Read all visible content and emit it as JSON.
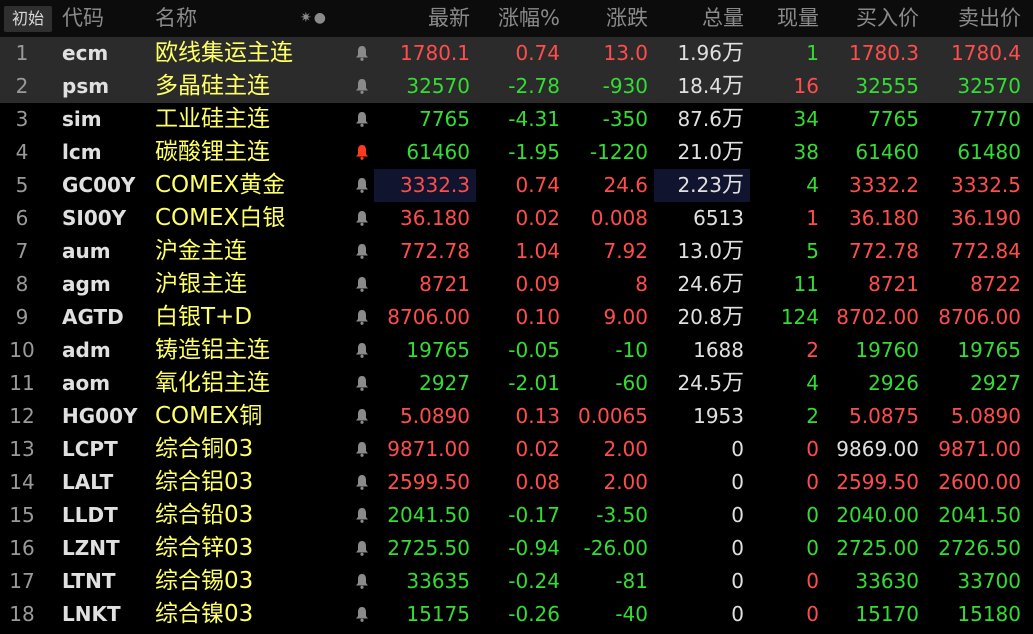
{
  "colors": {
    "up": "#ff4d4d",
    "down": "#33dd33",
    "name": "#ffff66",
    "background": "#000000"
  },
  "header": {
    "tab_label": "初始",
    "icons_text": "✷●",
    "columns": {
      "code": "代码",
      "name": "名称",
      "last": "最新",
      "pct": "涨幅%",
      "chg": "涨跌",
      "vol": "总量",
      "cur": "现量",
      "bid": "买入价",
      "ask": "卖出价"
    }
  },
  "rows": [
    {
      "idx": "1",
      "code": "ecm",
      "name": "欧线集运主连",
      "alert": false,
      "last": "1780.1",
      "pct": "0.74",
      "chg": "13.0",
      "vol": "1.96",
      "vol_unit": "万",
      "cur": "1",
      "bid": "1780.3",
      "ask": "1780.4",
      "last_dir": "up",
      "pct_dir": "up",
      "chg_dir": "up",
      "cur_dir": "down",
      "bid_dir": "up",
      "ask_dir": "up"
    },
    {
      "idx": "2",
      "code": "psm",
      "name": "多晶硅主连",
      "alert": false,
      "last": "32570",
      "pct": "-2.78",
      "chg": "-930",
      "vol": "18.4",
      "vol_unit": "万",
      "cur": "16",
      "bid": "32555",
      "ask": "32570",
      "last_dir": "down",
      "pct_dir": "down",
      "chg_dir": "down",
      "cur_dir": "up",
      "bid_dir": "down",
      "ask_dir": "down"
    },
    {
      "idx": "3",
      "code": "sim",
      "name": "工业硅主连",
      "alert": false,
      "last": "7765",
      "pct": "-4.31",
      "chg": "-350",
      "vol": "87.6",
      "vol_unit": "万",
      "cur": "34",
      "bid": "7765",
      "ask": "7770",
      "last_dir": "down",
      "pct_dir": "down",
      "chg_dir": "down",
      "cur_dir": "down",
      "bid_dir": "down",
      "ask_dir": "down"
    },
    {
      "idx": "4",
      "code": "lcm",
      "name": "碳酸锂主连",
      "alert": true,
      "last": "61460",
      "pct": "-1.95",
      "chg": "-1220",
      "vol": "21.0",
      "vol_unit": "万",
      "cur": "38",
      "bid": "61460",
      "ask": "61480",
      "last_dir": "down",
      "pct_dir": "down",
      "chg_dir": "down",
      "cur_dir": "down",
      "bid_dir": "down",
      "ask_dir": "down"
    },
    {
      "idx": "5",
      "code": "GC00Y",
      "name": "COMEX黄金",
      "alert": false,
      "last": "3332.3",
      "pct": "0.74",
      "chg": "24.6",
      "vol": "2.23",
      "vol_unit": "万",
      "cur": "4",
      "bid": "3332.2",
      "ask": "3332.5",
      "last_dir": "up",
      "pct_dir": "up",
      "chg_dir": "up",
      "cur_dir": "down",
      "bid_dir": "up",
      "ask_dir": "up"
    },
    {
      "idx": "6",
      "code": "SI00Y",
      "name": "COMEX白银",
      "alert": false,
      "last": "36.180",
      "pct": "0.02",
      "chg": "0.008",
      "vol": "6513",
      "vol_unit": "",
      "cur": "1",
      "bid": "36.180",
      "ask": "36.190",
      "last_dir": "up",
      "pct_dir": "up",
      "chg_dir": "up",
      "cur_dir": "up",
      "bid_dir": "up",
      "ask_dir": "up"
    },
    {
      "idx": "7",
      "code": "aum",
      "name": "沪金主连",
      "alert": false,
      "last": "772.78",
      "pct": "1.04",
      "chg": "7.92",
      "vol": "13.0",
      "vol_unit": "万",
      "cur": "5",
      "bid": "772.78",
      "ask": "772.84",
      "last_dir": "up",
      "pct_dir": "up",
      "chg_dir": "up",
      "cur_dir": "down",
      "bid_dir": "up",
      "ask_dir": "up"
    },
    {
      "idx": "8",
      "code": "agm",
      "name": "沪银主连",
      "alert": false,
      "last": "8721",
      "pct": "0.09",
      "chg": "8",
      "vol": "24.6",
      "vol_unit": "万",
      "cur": "11",
      "bid": "8721",
      "ask": "8722",
      "last_dir": "up",
      "pct_dir": "up",
      "chg_dir": "up",
      "cur_dir": "down",
      "bid_dir": "up",
      "ask_dir": "up"
    },
    {
      "idx": "9",
      "code": "AGTD",
      "name": "白银T+D",
      "alert": false,
      "last": "8706.00",
      "pct": "0.10",
      "chg": "9.00",
      "vol": "20.8",
      "vol_unit": "万",
      "cur": "124",
      "bid": "8702.00",
      "ask": "8706.00",
      "last_dir": "up",
      "pct_dir": "up",
      "chg_dir": "up",
      "cur_dir": "down",
      "bid_dir": "up",
      "ask_dir": "up"
    },
    {
      "idx": "10",
      "code": "adm",
      "name": "铸造铝主连",
      "alert": false,
      "last": "19765",
      "pct": "-0.05",
      "chg": "-10",
      "vol": "1688",
      "vol_unit": "",
      "cur": "2",
      "bid": "19760",
      "ask": "19765",
      "last_dir": "down",
      "pct_dir": "down",
      "chg_dir": "down",
      "cur_dir": "up",
      "bid_dir": "down",
      "ask_dir": "down"
    },
    {
      "idx": "11",
      "code": "aom",
      "name": "氧化铝主连",
      "alert": false,
      "last": "2927",
      "pct": "-2.01",
      "chg": "-60",
      "vol": "24.5",
      "vol_unit": "万",
      "cur": "4",
      "bid": "2926",
      "ask": "2927",
      "last_dir": "down",
      "pct_dir": "down",
      "chg_dir": "down",
      "cur_dir": "down",
      "bid_dir": "down",
      "ask_dir": "down"
    },
    {
      "idx": "12",
      "code": "HG00Y",
      "name": "COMEX铜",
      "alert": false,
      "last": "5.0890",
      "pct": "0.13",
      "chg": "0.0065",
      "vol": "1953",
      "vol_unit": "",
      "cur": "2",
      "bid": "5.0875",
      "ask": "5.0890",
      "last_dir": "up",
      "pct_dir": "up",
      "chg_dir": "up",
      "cur_dir": "down",
      "bid_dir": "up",
      "ask_dir": "up"
    },
    {
      "idx": "13",
      "code": "LCPT",
      "name": "综合铜03",
      "alert": false,
      "last": "9871.00",
      "pct": "0.02",
      "chg": "2.00",
      "vol": "0",
      "vol_unit": "",
      "cur": "0",
      "bid": "9869.00",
      "ask": "9871.00",
      "last_dir": "up",
      "pct_dir": "up",
      "chg_dir": "up",
      "cur_dir": "up",
      "bid_dir": "flat",
      "ask_dir": "up"
    },
    {
      "idx": "14",
      "code": "LALT",
      "name": "综合铝03",
      "alert": false,
      "last": "2599.50",
      "pct": "0.08",
      "chg": "2.00",
      "vol": "0",
      "vol_unit": "",
      "cur": "0",
      "bid": "2599.50",
      "ask": "2600.00",
      "last_dir": "up",
      "pct_dir": "up",
      "chg_dir": "up",
      "cur_dir": "up",
      "bid_dir": "up",
      "ask_dir": "up"
    },
    {
      "idx": "15",
      "code": "LLDT",
      "name": "综合铅03",
      "alert": false,
      "last": "2041.50",
      "pct": "-0.17",
      "chg": "-3.50",
      "vol": "0",
      "vol_unit": "",
      "cur": "0",
      "bid": "2040.00",
      "ask": "2041.50",
      "last_dir": "down",
      "pct_dir": "down",
      "chg_dir": "down",
      "cur_dir": "down",
      "bid_dir": "down",
      "ask_dir": "down"
    },
    {
      "idx": "16",
      "code": "LZNT",
      "name": "综合锌03",
      "alert": false,
      "last": "2725.50",
      "pct": "-0.94",
      "chg": "-26.00",
      "vol": "0",
      "vol_unit": "",
      "cur": "0",
      "bid": "2725.00",
      "ask": "2726.50",
      "last_dir": "down",
      "pct_dir": "down",
      "chg_dir": "down",
      "cur_dir": "down",
      "bid_dir": "down",
      "ask_dir": "down"
    },
    {
      "idx": "17",
      "code": "LTNT",
      "name": "综合锡03",
      "alert": false,
      "last": "33635",
      "pct": "-0.24",
      "chg": "-81",
      "vol": "0",
      "vol_unit": "",
      "cur": "0",
      "bid": "33630",
      "ask": "33700",
      "last_dir": "down",
      "pct_dir": "down",
      "chg_dir": "down",
      "cur_dir": "up",
      "bid_dir": "down",
      "ask_dir": "down"
    },
    {
      "idx": "18",
      "code": "LNKT",
      "name": "综合镍03",
      "alert": false,
      "last": "15175",
      "pct": "-0.26",
      "chg": "-40",
      "vol": "0",
      "vol_unit": "",
      "cur": "0",
      "bid": "15170",
      "ask": "15180",
      "last_dir": "down",
      "pct_dir": "down",
      "chg_dir": "down",
      "cur_dir": "up",
      "bid_dir": "down",
      "ask_dir": "down"
    }
  ]
}
